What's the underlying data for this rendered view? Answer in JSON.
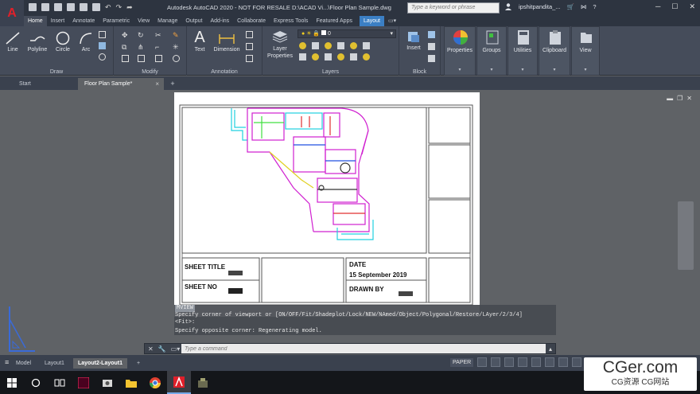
{
  "titlebar": {
    "app_letter": "A",
    "title": "Autodesk AutoCAD 2020 - NOT FOR RESALE   D:\\ACAD Vi...\\Floor Plan Sample.dwg",
    "search_placeholder": "Type a keyword or phrase",
    "user": "ipshitpandita_...",
    "help": "?"
  },
  "ribbon_tabs": [
    "Home",
    "Insert",
    "Annotate",
    "Parametric",
    "View",
    "Manage",
    "Output",
    "Add-ins",
    "Collaborate",
    "Express Tools",
    "Featured Apps"
  ],
  "ribbon_tab_layout": "Layout",
  "ribbon": {
    "draw": {
      "label": "Draw",
      "tools": [
        "Line",
        "Polyline",
        "Circle",
        "Arc"
      ]
    },
    "modify": {
      "label": "Modify"
    },
    "annotation": {
      "label": "Annotation",
      "tools": [
        "Text",
        "Dimension"
      ]
    },
    "layers": {
      "label": "Layers",
      "tool": "Layer Properties",
      "current_layer": "0"
    },
    "block": {
      "label": "Block",
      "tool": "Insert"
    },
    "properties": "Properties",
    "groups": "Groups",
    "utilities": "Utilities",
    "clipboard": "Clipboard",
    "view": "View"
  },
  "doc_tabs": {
    "start": "Start",
    "active": "Floor Plan Sample*",
    "close": "×",
    "plus": "+"
  },
  "sheet": {
    "title_label": "SHEET TITLE",
    "no_label": "SHEET NO",
    "date_label": "DATE",
    "date_value": "15 September 2019",
    "drawn_by_label": "DRAWN BY"
  },
  "command": {
    "history": [
      "MVIEW",
      "Specify corner of viewport or [ON/OFF/Fit/Shadeplot/Lock/NEW/NAmed/Object/Polygonal/Restore/LAyer/2/3/4]",
      "<Fit>:",
      "Specify opposite corner: Regenerating model."
    ],
    "placeholder": "Type a command"
  },
  "layout_tabs": [
    "Model",
    "Layout1",
    "Layout2-Layout1"
  ],
  "layout_plus": "+",
  "status": {
    "paper": "PAPER"
  },
  "watermark": {
    "big": "CGer.com",
    "small": "CG资源 CG网站"
  },
  "colors": {
    "accent": "#3b7fc4",
    "plan_magenta": "#d020d0",
    "plan_cyan": "#20d0e0",
    "plan_yellow": "#e0d020"
  }
}
